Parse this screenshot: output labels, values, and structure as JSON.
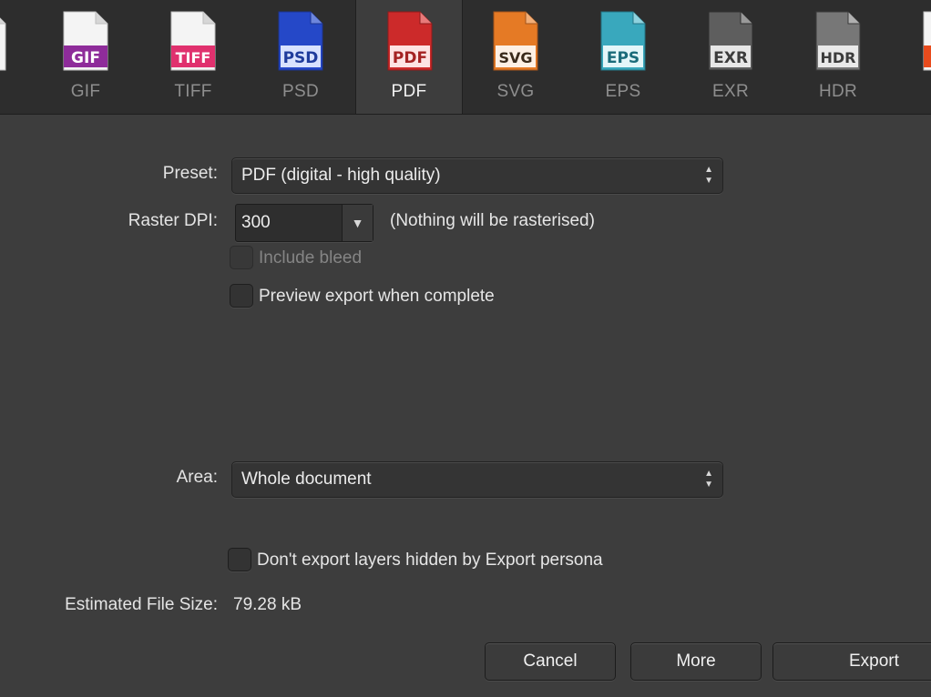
{
  "formats": [
    {
      "label": "",
      "badge": "",
      "color": "#d9d9d9"
    },
    {
      "label": "GIF",
      "badge": "GIF",
      "color": "#8e2c9a"
    },
    {
      "label": "TIFF",
      "badge": "TIFF",
      "color": "#e0316e"
    },
    {
      "label": "PSD",
      "badge": "PSD",
      "color": "#2548c8"
    },
    {
      "label": "PDF",
      "badge": "PDF",
      "color": "#cc2a2a"
    },
    {
      "label": "SVG",
      "badge": "SVG",
      "color": "#e57a25"
    },
    {
      "label": "EPS",
      "badge": "EPS",
      "color": "#39a8bd"
    },
    {
      "label": "EXR",
      "badge": "EXR",
      "color": "#6a6a6a"
    },
    {
      "label": "HDR",
      "badge": "HDR",
      "color": "#7c7c7c"
    },
    {
      "label": "",
      "badge": "",
      "color": "#e84b1d"
    }
  ],
  "selected_format": "PDF",
  "preset": {
    "label": "Preset:",
    "value": "PDF (digital - high quality)"
  },
  "raster_dpi": {
    "label": "Raster DPI:",
    "value": "300",
    "note": "(Nothing will be rasterised)"
  },
  "include_bleed": {
    "label": "Include bleed",
    "checked": false,
    "disabled": true
  },
  "preview_export": {
    "label": "Preview export when complete",
    "checked": false
  },
  "area": {
    "label": "Area:",
    "value": "Whole document"
  },
  "dont_export_hidden": {
    "label": "Don't export layers hidden by Export persona",
    "checked": false
  },
  "file_size": {
    "label": "Estimated File Size:",
    "value": "79.28 kB"
  },
  "buttons": {
    "cancel": "Cancel",
    "more": "More",
    "export": "Export"
  }
}
